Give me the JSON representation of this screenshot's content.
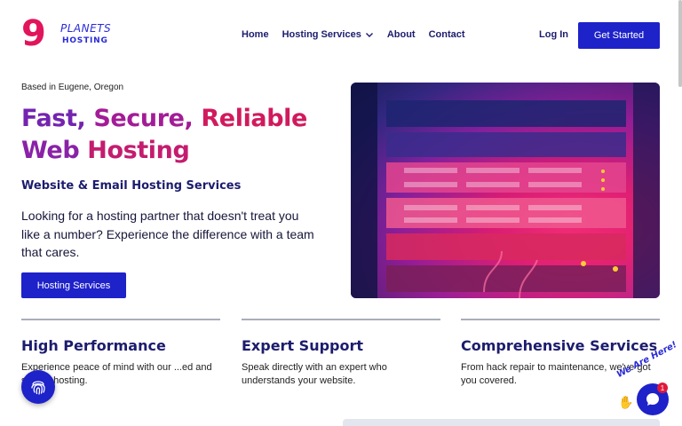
{
  "brand": {
    "logo_nine": "9",
    "logo_planets": "PLANETS",
    "logo_hosting": "HOSTING",
    "primary_color": "#1e22c9",
    "accent_pink": "#e2145c",
    "accent_purple": "#7424b0"
  },
  "nav": {
    "items": [
      {
        "label": "Home"
      },
      {
        "label": "Hosting Services",
        "has_dropdown": true,
        "icon": "chevron-down-icon"
      },
      {
        "label": "About"
      },
      {
        "label": "Contact"
      }
    ],
    "login_label": "Log In",
    "cta_label": "Get Started"
  },
  "hero": {
    "eyebrow": "Based in Eugene, Oregon",
    "title_parts": [
      "Fast,",
      "Secure,",
      "Reliable",
      "Web",
      "Hosting"
    ],
    "subheading": "Website & Email Hosting Services",
    "body": "Looking for a hosting partner that doesn't treat you like a number? Experience the difference with a team that cares.",
    "button_label": "Hosting Services",
    "image_icon": "server-rack-image"
  },
  "features": [
    {
      "title": "High Performance",
      "text": "Experience peace of mind with our ...ed and secure hosting."
    },
    {
      "title": "Expert Support",
      "text": "Speak directly with an expert who understands your website."
    },
    {
      "title": "Comprehensive Services",
      "text": "From hack repair to maintenance, we've got you covered."
    }
  ],
  "widgets": {
    "fingerprint_icon": "fingerprint-icon",
    "chat_label": "We Are Here!",
    "chat_icon": "chat-bubble-icon",
    "chat_badge_count": "1"
  }
}
